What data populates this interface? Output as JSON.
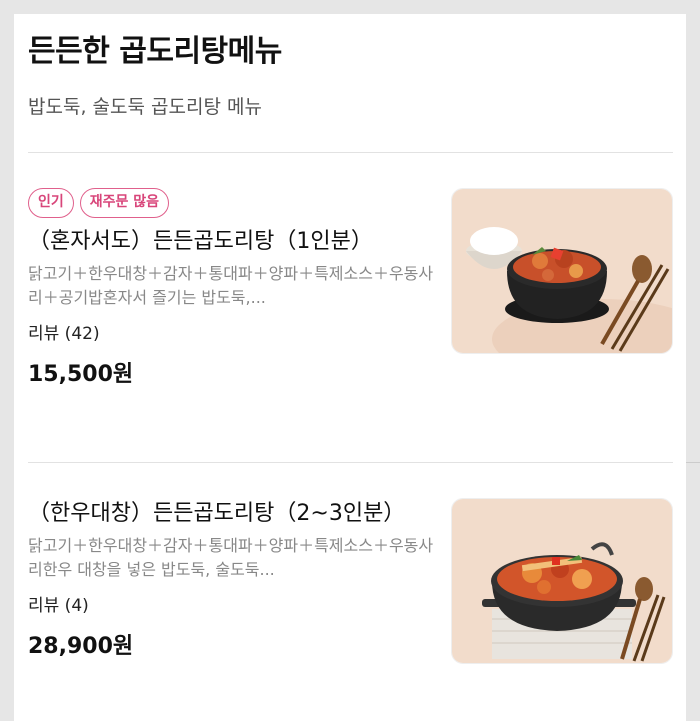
{
  "section": {
    "title": "든든한 곱도리탕메뉴",
    "subtitle": "밥도둑, 술도둑 곱도리탕 메뉴"
  },
  "items": [
    {
      "tags": [
        "인기",
        "재주문 많음"
      ],
      "name": "（혼자서도）든든곱도리탕（1인분）",
      "description": "닭고기＋한우대창＋감자＋통대파＋양파＋특제소스＋우동사리＋공기밥혼자서 즐기는 밥도둑,...",
      "reviews": "리뷰 (42)",
      "price": "15,500원",
      "image_icon": "stew-pot-with-rice-image"
    },
    {
      "tags": [],
      "name": "（한우대창）든든곱도리탕（2~3인분）",
      "description": "닭고기＋한우대창＋감자＋통대파＋양파＋특제소스＋우동사리한우 대창을 넣은 밥도둑, 술도둑...",
      "reviews": "리뷰 (4)",
      "price": "28,900원",
      "image_icon": "large-stew-pot-image"
    }
  ],
  "colors": {
    "accent_pink": "#d8457a",
    "background": "#e6e6e6",
    "card": "#ffffff"
  }
}
